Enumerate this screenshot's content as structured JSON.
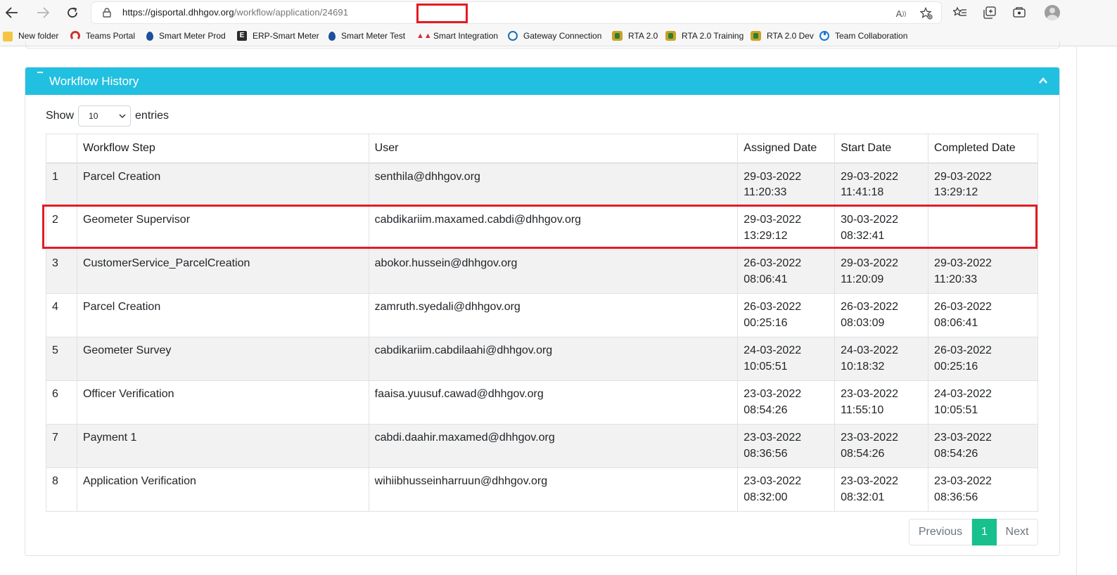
{
  "browser": {
    "url_host": "https://gisportal.dhhgov.org",
    "url_path": "/workflow/application/24691",
    "bookmarks": [
      {
        "label": "New folder",
        "icon": "folder-icon"
      },
      {
        "label": "Teams Portal",
        "icon": "teams-icon"
      },
      {
        "label": "Smart Meter Prod",
        "icon": "water-drop-icon"
      },
      {
        "label": "ERP-Smart Meter",
        "icon": "erp-icon"
      },
      {
        "label": "Smart Meter Test",
        "icon": "water-drop-icon"
      },
      {
        "label": "Smart Integration",
        "icon": "smart-integration-icon"
      },
      {
        "label": "Gateway Connection",
        "icon": "gateway-icon"
      },
      {
        "label": "RTA 2.0",
        "icon": "rta-icon"
      },
      {
        "label": "RTA 2.0 Training",
        "icon": "rta-icon"
      },
      {
        "label": "RTA 2.0 Dev",
        "icon": "rta-icon"
      },
      {
        "label": "Team Collaboration",
        "icon": "team-collaboration-icon"
      }
    ]
  },
  "panel": {
    "title": "Workflow History",
    "show_label": "Show",
    "entries_label": "entries",
    "page_length": "10"
  },
  "table": {
    "columns": [
      "",
      "Workflow Step",
      "User",
      "Assigned Date",
      "Start Date",
      "Completed Date"
    ],
    "rows": [
      {
        "no": "1",
        "step": "Parcel Creation",
        "user": "senthila@dhhgov.org",
        "assigned_date": "29-03-2022",
        "assigned_time": "11:20:33",
        "start_date": "29-03-2022",
        "start_time": "11:41:18",
        "completed_date": "29-03-2022",
        "completed_time": "13:29:12"
      },
      {
        "no": "2",
        "step": "Geometer Supervisor",
        "user": "cabdikariim.maxamed.cabdi@dhhgov.org",
        "assigned_date": "29-03-2022",
        "assigned_time": "13:29:12",
        "start_date": "30-03-2022",
        "start_time": "08:32:41",
        "completed_date": "",
        "completed_time": ""
      },
      {
        "no": "3",
        "step": "CustomerService_ParcelCreation",
        "user": "abokor.hussein@dhhgov.org",
        "assigned_date": "26-03-2022",
        "assigned_time": "08:06:41",
        "start_date": "29-03-2022",
        "start_time": "11:20:09",
        "completed_date": "29-03-2022",
        "completed_time": "11:20:33"
      },
      {
        "no": "4",
        "step": "Parcel Creation",
        "user": "zamruth.syedali@dhhgov.org",
        "assigned_date": "26-03-2022",
        "assigned_time": "00:25:16",
        "start_date": "26-03-2022",
        "start_time": "08:03:09",
        "completed_date": "26-03-2022",
        "completed_time": "08:06:41"
      },
      {
        "no": "5",
        "step": "Geometer Survey",
        "user": "cabdikariim.cabdilaahi@dhhgov.org",
        "assigned_date": "24-03-2022",
        "assigned_time": "10:05:51",
        "start_date": "24-03-2022",
        "start_time": "10:18:32",
        "completed_date": "26-03-2022",
        "completed_time": "00:25:16"
      },
      {
        "no": "6",
        "step": "Officer Verification",
        "user": "faaisa.yuusuf.cawad@dhhgov.org",
        "assigned_date": "23-03-2022",
        "assigned_time": "08:54:26",
        "start_date": "23-03-2022",
        "start_time": "11:55:10",
        "completed_date": "24-03-2022",
        "completed_time": "10:05:51"
      },
      {
        "no": "7",
        "step": "Payment 1",
        "user": "cabdi.daahir.maxamed@dhhgov.org",
        "assigned_date": "23-03-2022",
        "assigned_time": "08:36:56",
        "start_date": "23-03-2022",
        "start_time": "08:54:26",
        "completed_date": "23-03-2022",
        "completed_time": "08:54:26"
      },
      {
        "no": "8",
        "step": "Application Verification",
        "user": "wihiibhusseinharruun@dhhgov.org",
        "assigned_date": "23-03-2022",
        "assigned_time": "08:32:00",
        "start_date": "23-03-2022",
        "start_time": "08:32:01",
        "completed_date": "23-03-2022",
        "completed_time": "08:36:56"
      }
    ]
  },
  "pagination": {
    "previous": "Previous",
    "current": "1",
    "next": "Next"
  },
  "colors": {
    "header_bg": "#22c0e0",
    "active_page": "#17c08c",
    "annotation_red": "#e31b23"
  }
}
